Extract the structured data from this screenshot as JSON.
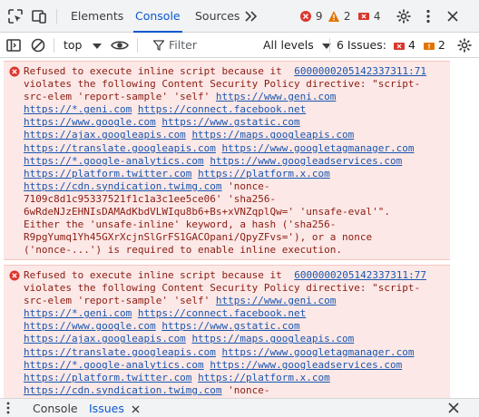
{
  "tabs": [
    {
      "label": "Elements"
    },
    {
      "label": "Console"
    },
    {
      "label": "Sources"
    }
  ],
  "counts": {
    "errors": "9",
    "warnings": "2",
    "issues": "4"
  },
  "toolbar": {
    "context": "top",
    "filter_placeholder": "Filter",
    "levels": "All levels",
    "issues_label": "6 Issues:",
    "issues_errors": "4",
    "issues_warnings": "2"
  },
  "messages": [
    {
      "source": "6000000205142337311:71",
      "lines": [
        [
          {
            "t": "Refused to execute inline script because it"
          }
        ],
        [
          {
            "t": "violates the following Content Security Policy directive: \"script-"
          }
        ],
        [
          {
            "t": "src-elem 'report-sample' 'self' "
          },
          {
            "t": "https://www.geni.com",
            "link": true
          }
        ],
        [
          {
            "t": "https://*.geni.com",
            "link": true
          },
          {
            "t": " "
          },
          {
            "t": "https://connect.facebook.net",
            "link": true
          }
        ],
        [
          {
            "t": "https://www.google.com",
            "link": true
          },
          {
            "t": " "
          },
          {
            "t": "https://www.gstatic.com",
            "link": true
          }
        ],
        [
          {
            "t": "https://ajax.googleapis.com",
            "link": true
          },
          {
            "t": " "
          },
          {
            "t": "https://maps.googleapis.com",
            "link": true
          }
        ],
        [
          {
            "t": "https://translate.googleapis.com",
            "link": true
          },
          {
            "t": " "
          },
          {
            "t": "https://www.googletagmanager.com",
            "link": true
          }
        ],
        [
          {
            "t": "https://*.google-analytics.com",
            "link": true
          },
          {
            "t": " "
          },
          {
            "t": "https://www.googleadservices.com",
            "link": true
          }
        ],
        [
          {
            "t": "https://platform.twitter.com",
            "link": true
          },
          {
            "t": " "
          },
          {
            "t": "https://platform.x.com",
            "link": true
          }
        ],
        [
          {
            "t": "https://cdn.syndication.twimg.com",
            "link": true
          },
          {
            "t": " 'nonce-"
          }
        ],
        [
          {
            "t": "7109c8d1c95337521f1c1a3c1ee5ce06' 'sha256-"
          }
        ],
        [
          {
            "t": "6wRdeNJzEHNIsDAMAdKbdVLWIqu8b6+Bs+xVNZqplQw=' 'unsafe-eval'\"."
          }
        ],
        [
          {
            "t": "Either the 'unsafe-inline' keyword, a hash ('sha256-"
          }
        ],
        [
          {
            "t": "R9pgYumq1Yh45GXrXcjnSlGrFS1GACOpani/QpyZFvs='), or a nonce"
          }
        ],
        [
          {
            "t": "('nonce-...') is required to enable inline execution."
          }
        ]
      ]
    },
    {
      "source": "6000000205142337311:77",
      "lines": [
        [
          {
            "t": "Refused to execute inline script because it"
          }
        ],
        [
          {
            "t": "violates the following Content Security Policy directive: \"script-"
          }
        ],
        [
          {
            "t": "src-elem 'report-sample' 'self' "
          },
          {
            "t": "https://www.geni.com",
            "link": true
          }
        ],
        [
          {
            "t": "https://*.geni.com",
            "link": true
          },
          {
            "t": " "
          },
          {
            "t": "https://connect.facebook.net",
            "link": true
          }
        ],
        [
          {
            "t": "https://www.google.com",
            "link": true
          },
          {
            "t": " "
          },
          {
            "t": "https://www.gstatic.com",
            "link": true
          }
        ],
        [
          {
            "t": "https://ajax.googleapis.com",
            "link": true
          },
          {
            "t": " "
          },
          {
            "t": "https://maps.googleapis.com",
            "link": true
          }
        ],
        [
          {
            "t": "https://translate.googleapis.com",
            "link": true
          },
          {
            "t": " "
          },
          {
            "t": "https://www.googletagmanager.com",
            "link": true
          }
        ],
        [
          {
            "t": "https://*.google-analytics.com",
            "link": true
          },
          {
            "t": " "
          },
          {
            "t": "https://www.googleadservices.com",
            "link": true
          }
        ],
        [
          {
            "t": "https://platform.twitter.com",
            "link": true
          },
          {
            "t": " "
          },
          {
            "t": "https://platform.x.com",
            "link": true
          }
        ],
        [
          {
            "t": "https://cdn.syndication.twimg.com",
            "link": true
          },
          {
            "t": " 'nonce-"
          }
        ]
      ]
    }
  ],
  "drawer": {
    "console_label": "Console",
    "issues_label": "Issues"
  },
  "icons": {
    "inspect": "inspect-element-icon",
    "device": "device-toolbar-icon",
    "more_tabs": "more-tabs-icon",
    "settings": "settings-gear-icon",
    "menu": "kebab-menu-icon",
    "close": "close-icon",
    "sidebar": "sidebar-toggle-icon",
    "clear": "clear-console-icon",
    "eye": "live-expression-eye-icon",
    "filter": "filter-icon"
  },
  "colors": {
    "accent": "#0b57d0",
    "error_bg": "#fce8e6",
    "error_text": "#8a1c12",
    "error_red": "#dc362e",
    "warning_orange": "#e37400",
    "link": "#1a56b0"
  }
}
